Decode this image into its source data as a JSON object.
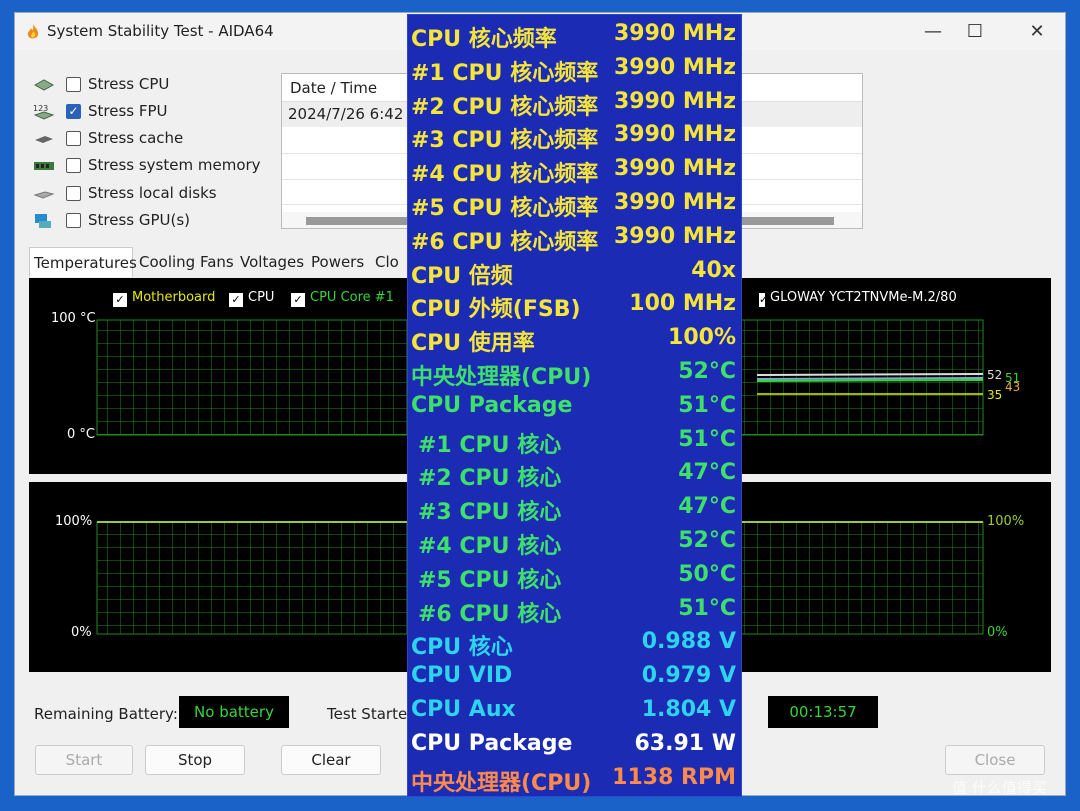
{
  "window": {
    "title": "System Stability Test - AIDA64"
  },
  "controls": {
    "minimize": "—",
    "maximize": "☐",
    "close": "✕"
  },
  "stress": [
    {
      "label": "Stress CPU",
      "checked": false,
      "icon": "cpu-icon"
    },
    {
      "label": "Stress FPU",
      "checked": true,
      "icon": "fpu-icon"
    },
    {
      "label": "Stress cache",
      "checked": false,
      "icon": "cache-icon"
    },
    {
      "label": "Stress system memory",
      "checked": false,
      "icon": "memory-icon"
    },
    {
      "label": "Stress local disks",
      "checked": false,
      "icon": "disk-icon"
    },
    {
      "label": "Stress GPU(s)",
      "checked": false,
      "icon": "gpu-icon"
    }
  ],
  "log": {
    "header": "Date / Time",
    "row1": "2024/7/26 6:42"
  },
  "tabs": [
    "Temperatures",
    "Cooling Fans",
    "Voltages",
    "Powers",
    "Clo"
  ],
  "temp_graph": {
    "y_max": "100 °C",
    "y_min": "0 °C",
    "legend": [
      {
        "label": "Motherboard",
        "color": "#e8e800"
      },
      {
        "label": "CPU",
        "color": "#ffffff"
      },
      {
        "label": "CPU Core #1",
        "color": "#39d439"
      },
      {
        "label": "GLOWAY YCT2TNVMe-M.2/80",
        "color": "#ffffff"
      }
    ],
    "right_labels": [
      "52",
      "51",
      "43",
      "35"
    ]
  },
  "usage_graph": {
    "y_max": "100%",
    "y_min": "0%",
    "right_max": "100%",
    "right_min": "0%"
  },
  "bottom": {
    "battery_label": "Remaining Battery:",
    "battery_value": "No battery",
    "test_started_label": "Test Starte",
    "elapsed": "00:13:57"
  },
  "buttons": {
    "start": "Start",
    "stop": "Stop",
    "clear": "Clear",
    "close": "Close"
  },
  "osd": [
    {
      "label": "CPU 核心频率",
      "value": "3990 MHz",
      "color": "#f5e43a",
      "indent": 0
    },
    {
      "label": "#1 CPU 核心频率",
      "value": "3990 MHz",
      "color": "#f5e43a",
      "indent": 0
    },
    {
      "label": "#2 CPU 核心频率",
      "value": "3990 MHz",
      "color": "#f5e43a",
      "indent": 0
    },
    {
      "label": "#3 CPU 核心频率",
      "value": "3990 MHz",
      "color": "#f5e43a",
      "indent": 0
    },
    {
      "label": "#4 CPU 核心频率",
      "value": "3990 MHz",
      "color": "#f5e43a",
      "indent": 0
    },
    {
      "label": "#5 CPU 核心频率",
      "value": "3990 MHz",
      "color": "#f5e43a",
      "indent": 0
    },
    {
      "label": "#6 CPU 核心频率",
      "value": "3990 MHz",
      "color": "#f5e43a",
      "indent": 0
    },
    {
      "label": "CPU 倍频",
      "value": "40x",
      "color": "#f5e43a",
      "indent": 0
    },
    {
      "label": "CPU 外频(FSB)",
      "value": "100 MHz",
      "color": "#f5e43a",
      "indent": 0
    },
    {
      "label": "CPU 使用率",
      "value": "100%",
      "color": "#f5e43a",
      "indent": 0
    },
    {
      "label": "中央处理器(CPU)",
      "value": "52°C",
      "color": "#3ee06a",
      "indent": 0
    },
    {
      "label": "CPU Package",
      "value": "51°C",
      "color": "#3ee06a",
      "indent": 0
    },
    {
      "label": "#1 CPU 核心",
      "value": "51°C",
      "color": "#3ee06a",
      "indent": 1
    },
    {
      "label": "#2 CPU 核心",
      "value": "47°C",
      "color": "#3ee06a",
      "indent": 1
    },
    {
      "label": "#3 CPU 核心",
      "value": "47°C",
      "color": "#3ee06a",
      "indent": 1
    },
    {
      "label": "#4 CPU 核心",
      "value": "52°C",
      "color": "#3ee06a",
      "indent": 1
    },
    {
      "label": "#5 CPU 核心",
      "value": "50°C",
      "color": "#3ee06a",
      "indent": 1
    },
    {
      "label": "#6 CPU 核心",
      "value": "51°C",
      "color": "#3ee06a",
      "indent": 1
    },
    {
      "label": "CPU 核心",
      "value": "0.988 V",
      "color": "#2ed3ee",
      "indent": 0
    },
    {
      "label": "CPU VID",
      "value": "0.979 V",
      "color": "#2ed3ee",
      "indent": 0
    },
    {
      "label": "CPU Aux",
      "value": "1.804 V",
      "color": "#2ed3ee",
      "indent": 0
    },
    {
      "label": "CPU Package",
      "value": "63.91 W",
      "color": "#ffffff",
      "indent": 0
    },
    {
      "label": "中央处理器(CPU)",
      "value": "1138 RPM",
      "color": "#ff8a4a",
      "indent": 0
    }
  ],
  "watermark": "值 什么值得买"
}
